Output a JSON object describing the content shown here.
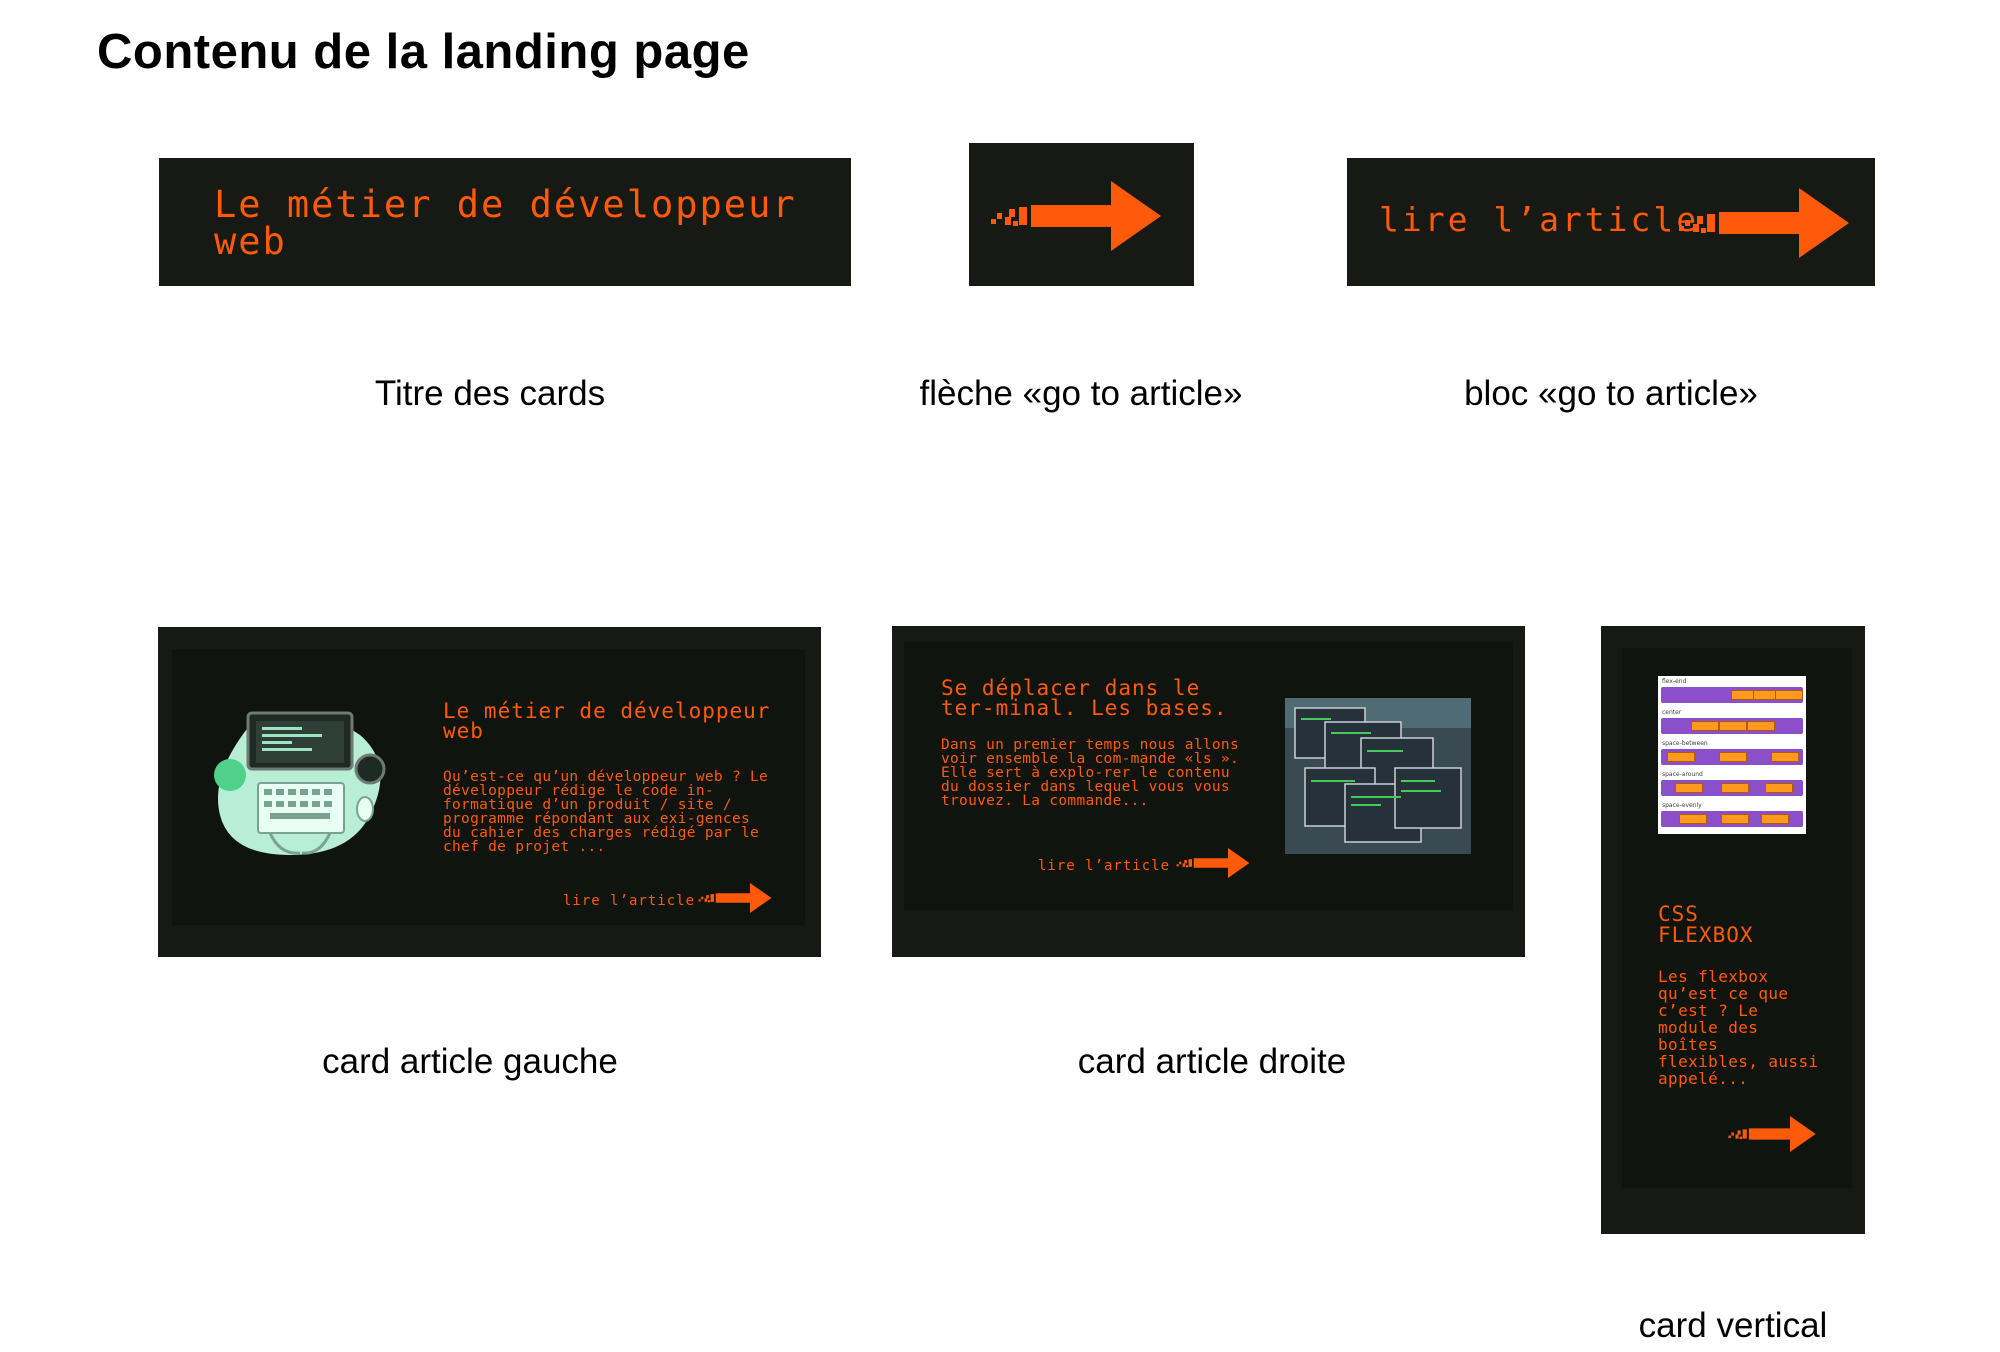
{
  "page": {
    "title": "Contenu de la landing page"
  },
  "colors": {
    "accent": "#ff5a0a",
    "card_bg": "#171915",
    "card_inner": "#10140e",
    "illustration_green": "#b9eed6"
  },
  "components": {
    "card_title": {
      "text": "Le métier de développeur web",
      "caption": "Titre des cards"
    },
    "arrow": {
      "icon": "arrow-right-icon",
      "caption": "flèche «go to article»"
    },
    "go_block": {
      "label": "lire l’article",
      "caption": "bloc «go to article»"
    }
  },
  "cards": {
    "left": {
      "title": "Le métier de développeur web",
      "desc": "Qu’est-ce qu’un développeur web ? Le développeur rédige le code in-formatique d’un produit / site / programme répondant aux exi-gences du cahier des charges rédigé par le chef de projet ...",
      "read": "lire l’article",
      "image": "developer-laptop-illustration",
      "caption": "card article gauche"
    },
    "right": {
      "title": "Se déplacer dans le ter-minal. Les bases.",
      "desc": "Dans un premier temps nous allons voir ensemble la com-mande «ls ». Elle sert à explo-rer le contenu du dossier dans lequel vous vous trouvez. La commande...",
      "read": "lire l’article",
      "image": "terminal-windows-image",
      "caption": "card article droite"
    },
    "vertical": {
      "title": "CSS FLEXBOX",
      "desc": "Les flexbox qu’est ce que c’est ? Le module des boîtes flexibles, aussi appelé...",
      "image": "flexbox-justify-diagram",
      "flex_labels": [
        "flex-end",
        "center",
        "space-between",
        "space-around",
        "space-evenly"
      ],
      "caption": "card vertical"
    }
  }
}
